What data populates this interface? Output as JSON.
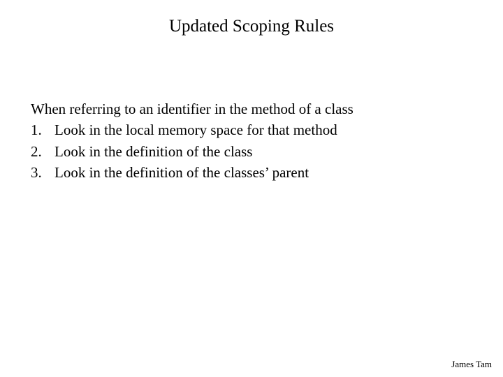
{
  "title": "Updated Scoping Rules",
  "intro": "When referring to an identifier in the method of a class",
  "items": [
    {
      "num": "1.",
      "text": "Look in the local memory space for that method"
    },
    {
      "num": "2.",
      "text": "Look in the definition of the class"
    },
    {
      "num": "3.",
      "text": "Look in the definition of the classes’ parent"
    }
  ],
  "footer": "James Tam"
}
